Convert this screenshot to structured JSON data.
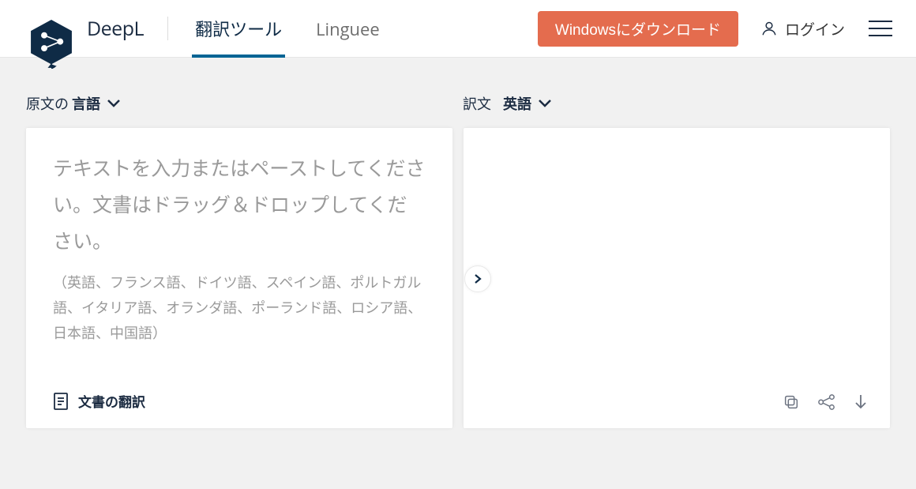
{
  "brand": {
    "name": "DeepL"
  },
  "nav": {
    "translator": "翻訳ツール",
    "linguee": "Linguee"
  },
  "header": {
    "download_btn": "Windowsにダウンロード",
    "login": "ログイン"
  },
  "source": {
    "prefix": "原文の",
    "lang": "言語"
  },
  "target": {
    "prefix": "訳文",
    "lang": "英語"
  },
  "input": {
    "placeholder": "テキストを入力またはペーストしてください。文書はドラッグ＆ドロップしてください。",
    "languages": "（英語、フランス語、ドイツ語、スペイン語、ポルトガル語、イタリア語、オランダ語、ポーランド語、ロシア語、日本語、中国語）",
    "doc_translate": "文書の翻訳"
  },
  "colors": {
    "brand_navy": "#0f2b46",
    "nav_underline": "#006494",
    "accent_orange": "#e46c4e",
    "bg": "#f1f1f1"
  }
}
